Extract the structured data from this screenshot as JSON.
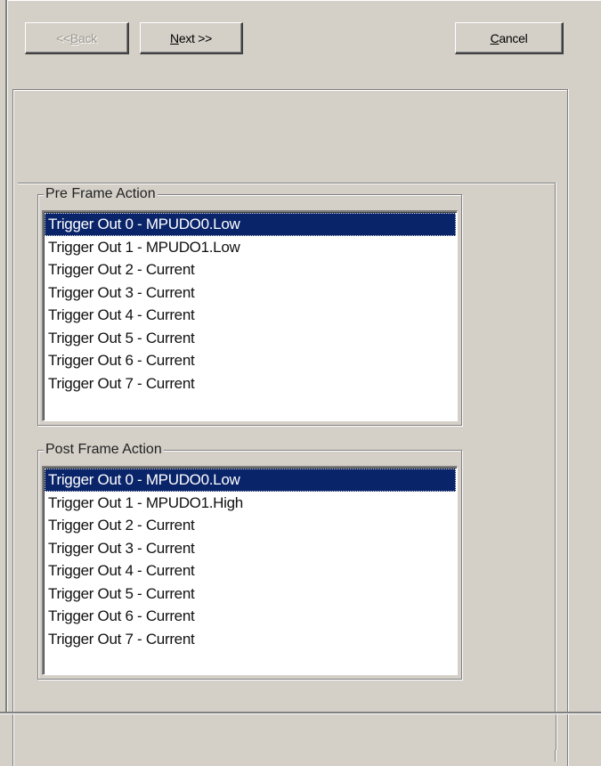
{
  "toolbar": {
    "back": {
      "prefix": "<< ",
      "mnemonic": "B",
      "rest": "ack",
      "disabled": true
    },
    "next": {
      "mnemonic": "N",
      "rest": "ext >>"
    },
    "cancel": {
      "mnemonic": "C",
      "rest": "ancel"
    }
  },
  "pre_frame": {
    "title": "Pre Frame Action",
    "selected_index": 0,
    "items": [
      "Trigger Out 0 - MPUDO0.Low",
      "Trigger Out 1 - MPUDO1.Low",
      "Trigger Out 2 - Current",
      "Trigger Out 3 - Current",
      "Trigger Out 4 - Current",
      "Trigger Out 5 - Current",
      "Trigger Out 6 - Current",
      "Trigger Out 7 - Current"
    ]
  },
  "post_frame": {
    "title": "Post Frame Action",
    "selected_index": 0,
    "items": [
      "Trigger Out 0 - MPUDO0.Low",
      "Trigger Out 1 - MPUDO1.High",
      "Trigger Out 2 - Current",
      "Trigger Out 3 - Current",
      "Trigger Out 4 - Current",
      "Trigger Out 5 - Current",
      "Trigger Out 6 - Current",
      "Trigger Out 7 - Current"
    ]
  },
  "colors": {
    "face": "#d4d0c8",
    "selection": "#0a246a",
    "disabled_text": "#9a978f"
  }
}
